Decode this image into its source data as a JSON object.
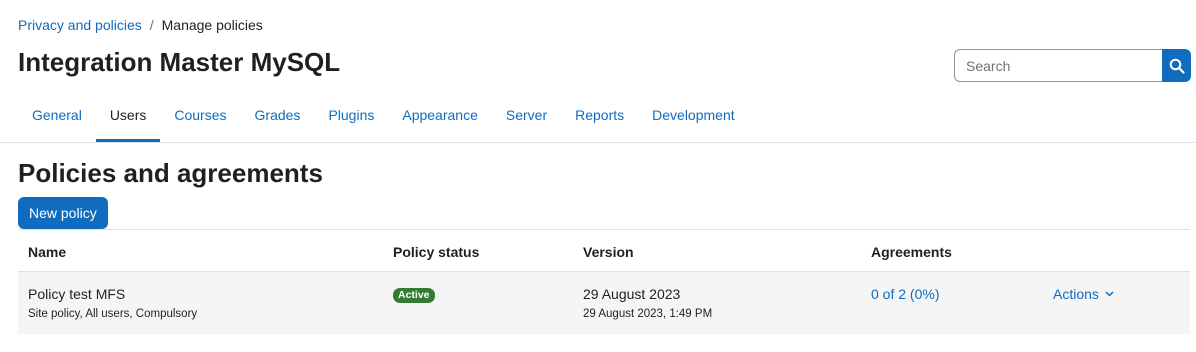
{
  "breadcrumb": {
    "parent": "Privacy and policies",
    "separator": "/",
    "current": "Manage policies"
  },
  "site_title": "Integration Master MySQL",
  "search": {
    "placeholder": "Search",
    "icon": "search-icon"
  },
  "tabs": [
    {
      "label": "General"
    },
    {
      "label": "Users",
      "active": true
    },
    {
      "label": "Courses"
    },
    {
      "label": "Grades"
    },
    {
      "label": "Plugins"
    },
    {
      "label": "Appearance"
    },
    {
      "label": "Server"
    },
    {
      "label": "Reports"
    },
    {
      "label": "Development"
    }
  ],
  "page_heading": "Policies and agreements",
  "new_policy_label": "New policy",
  "table": {
    "headers": {
      "name": "Name",
      "status": "Policy status",
      "version": "Version",
      "agreements": "Agreements"
    },
    "rows": [
      {
        "name": "Policy test MFS",
        "details": "Site policy, All users, Compulsory",
        "status": "Active",
        "version": "29 August 2023",
        "version_time": "29 August 2023, 1:49 PM",
        "agreements": "0 of 2 (0%)",
        "actions": "Actions"
      }
    ]
  },
  "colors": {
    "accent": "#0f6cbf",
    "active_badge": "#357a32",
    "row_background": "#f5f5f5"
  }
}
